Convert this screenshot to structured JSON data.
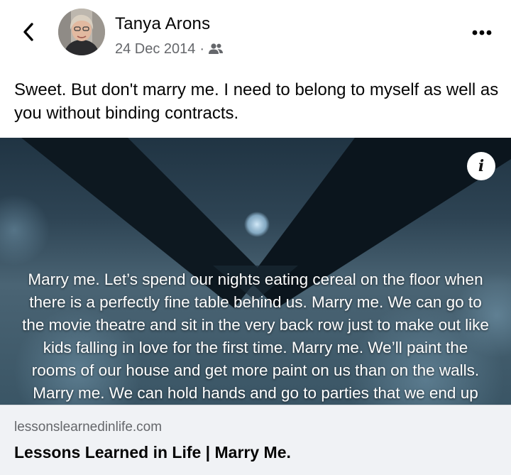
{
  "post": {
    "author_name": "Tanya Arons",
    "date": "24 Dec 2014",
    "separator": "·",
    "audience_icon": "friends-icon",
    "text": "Sweet.  But don't marry me.  I need to belong to myself as well as you without binding contracts."
  },
  "link_preview": {
    "image_quote": "Marry me. Let’s spend our nights eating cereal on the floor when there is a perfectly fine table behind us. Marry me. We can go to the movie theatre and sit in the very back row just to make out like kids falling in love for the first time. Marry me. We’ll paint the rooms of our house and get more paint on us than on the walls. Marry me. We can hold hands and go to parties that we end up ditching",
    "info_label": "i",
    "domain": "lessonslearnedinlife.com",
    "title": "Lessons Learned in Life | Marry Me."
  },
  "colors": {
    "text_primary": "#050505",
    "text_secondary": "#65676b",
    "footer_bg": "#f0f2f5"
  }
}
